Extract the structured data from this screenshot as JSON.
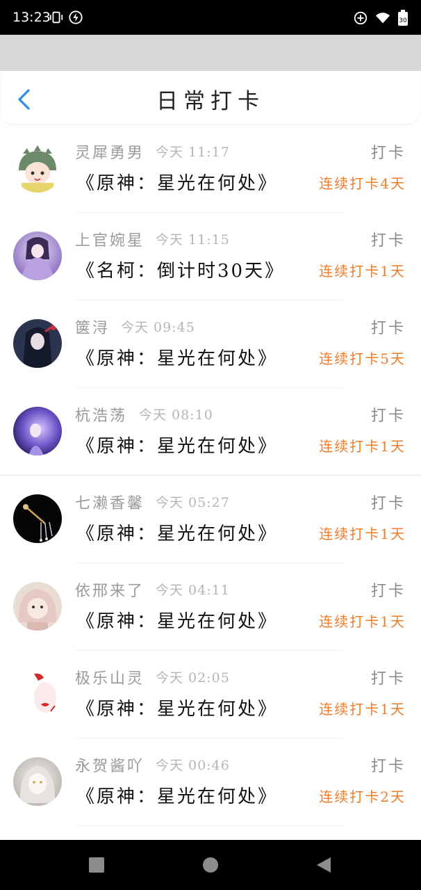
{
  "status_bar": {
    "time": "13:23",
    "battery_level": "30",
    "icons": [
      "vibrate-icon",
      "charging-bolt-icon",
      "data-saver-icon",
      "wifi-icon",
      "battery-icon"
    ]
  },
  "header": {
    "title": "日常打卡",
    "back_icon": "chevron-left-icon",
    "accent": "#2a8bea"
  },
  "checkins": [
    {
      "name": "灵犀勇男",
      "time": "今天 11:17",
      "topic": "《原神：星光在何处》",
      "action": "打卡",
      "streak": "连续打卡4天",
      "avatar": "green-dino-hood-avatar"
    },
    {
      "name": "上官婉星",
      "time": "今天 11:15",
      "topic": "《名柯：倒计时30天》",
      "action": "打卡",
      "streak": "连续打卡1天",
      "avatar": "purple-girl-avatar"
    },
    {
      "name": "箧浔",
      "time": "今天 09:45",
      "topic": "《原神：星光在何处》",
      "action": "打卡",
      "streak": "连续打卡5天",
      "avatar": "dark-anime-girl-avatar"
    },
    {
      "name": "杭浩荡",
      "time": "今天 08:10",
      "topic": "《原神：星光在何处》",
      "action": "打卡",
      "streak": "连续打卡1天",
      "avatar": "violet-glow-avatar"
    },
    {
      "name": "七濑香馨",
      "time": "今天 05:27",
      "topic": "《原神：星光在何处》",
      "action": "打卡",
      "streak": "连续打卡1天",
      "avatar": "hairpin-black-avatar"
    },
    {
      "name": "依邢来了",
      "time": "今天 04:11",
      "topic": "《原神：星光在何处》",
      "action": "打卡",
      "streak": "连续打卡1天",
      "avatar": "pink-hood-baby-avatar"
    },
    {
      "name": "极乐山灵",
      "time": "今天 02:05",
      "topic": "《原神：星光在何处》",
      "action": "打卡",
      "streak": "连续打卡1天",
      "avatar": "love-lips-avatar"
    },
    {
      "name": "永贺酱吖",
      "time": "今天 00:46",
      "topic": "《原神：星光在何处》",
      "action": "打卡",
      "streak": "连续打卡2天",
      "avatar": "white-hair-girl-avatar"
    }
  ],
  "colors": {
    "streak": "#f07b2a",
    "name": "#9a9a9a",
    "topic": "#111111"
  },
  "nav_bar": {
    "icons": [
      "recents-square-icon",
      "home-circle-icon",
      "back-triangle-icon"
    ]
  }
}
